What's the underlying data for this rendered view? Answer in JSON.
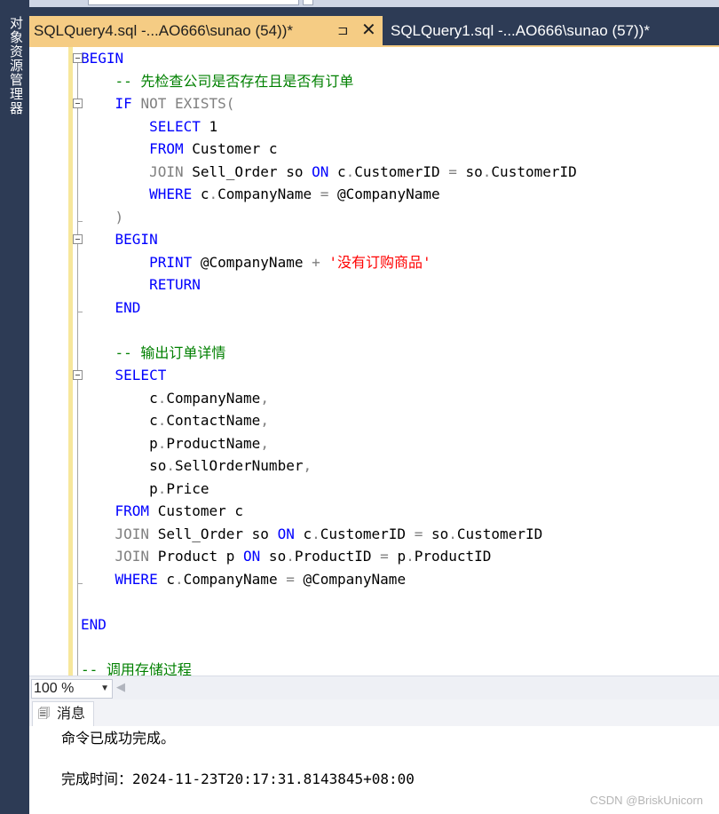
{
  "sidebar": {
    "label": "对象资源管理器"
  },
  "tabs": [
    {
      "title": "SQLQuery4.sql -...AO666\\sunao (54))*",
      "pin": "⊐",
      "close": "✕"
    },
    {
      "title": "SQLQuery1.sql -...AO666\\sunao (57))*"
    }
  ],
  "editor": {
    "lines": [
      "BEGIN",
      "    -- 先检查公司是否存在且是否有订单",
      "    IF NOT EXISTS(",
      "        SELECT 1",
      "        FROM Customer c",
      "        JOIN Sell_Order so ON c.CustomerID = so.CustomerID",
      "        WHERE c.CompanyName = @CompanyName",
      "    )",
      "    BEGIN",
      "        PRINT @CompanyName + '没有订购商品'",
      "        RETURN",
      "    END",
      "",
      "    -- 输出订单详情",
      "    SELECT",
      "        c.CompanyName,",
      "        c.ContactName,",
      "        p.ProductName,",
      "        so.SellOrderNumber,",
      "        p.Price",
      "    FROM Customer c",
      "    JOIN Sell_Order so ON c.CustomerID = so.CustomerID",
      "    JOIN Product p ON so.ProductID = p.ProductID",
      "    WHERE c.CompanyName = @CompanyName",
      "",
      "END",
      "",
      "-- 调用存储过程"
    ]
  },
  "zoom": {
    "value": "100 %"
  },
  "messages": {
    "tab_label": "消息",
    "line1": "命令已成功完成。",
    "line2_label": "完成时间：",
    "line2_value": "2024-11-23T20:17:31.8143845+08:00"
  },
  "watermark": "CSDN @BriskUnicorn",
  "colors": {
    "keyword": "#0000ff",
    "comment": "#008000",
    "string": "#ff0000",
    "operator": "#808080",
    "active_tab": "#f5cc84",
    "chrome": "#2d3b55"
  }
}
